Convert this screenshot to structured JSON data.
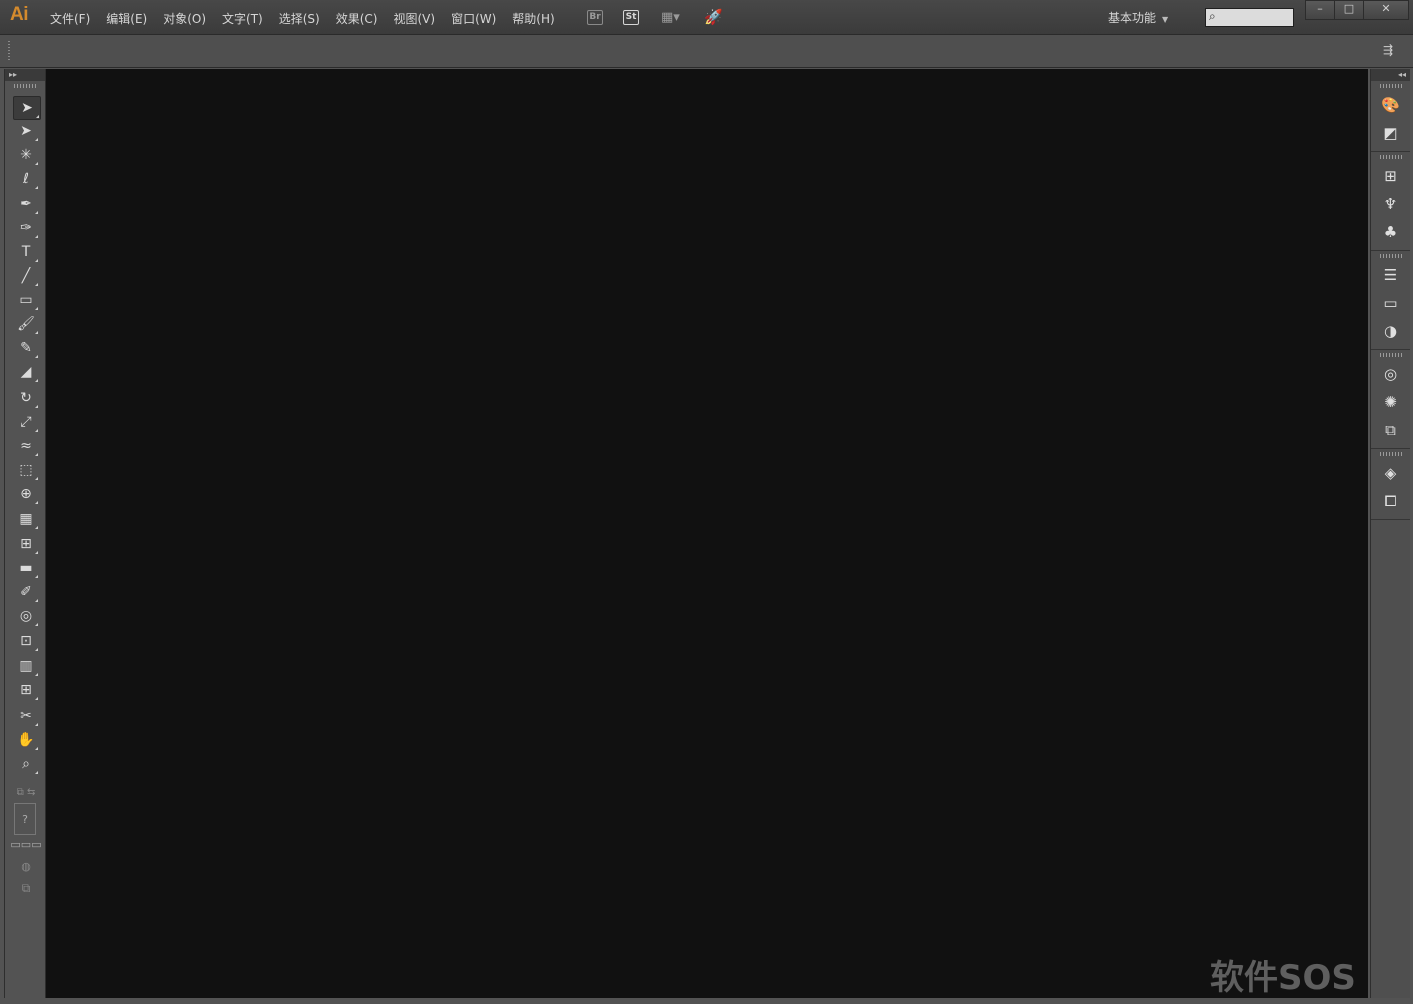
{
  "app": {
    "logo": "Ai",
    "menus": [
      "文件(F)",
      "编辑(E)",
      "对象(O)",
      "文字(T)",
      "选择(S)",
      "效果(C)",
      "视图(V)",
      "窗口(W)",
      "帮助(H)"
    ],
    "bridge_label": "Br",
    "stock_label": "St",
    "workspace": "基本功能",
    "search_placeholder": "",
    "window_controls": {
      "minimize": "–",
      "restore": "□",
      "close": "✕"
    }
  },
  "tools": [
    {
      "name": "selection-tool",
      "glyph": "➤",
      "active": true
    },
    {
      "name": "direct-selection-tool",
      "glyph": "➤"
    },
    {
      "name": "magic-wand-tool",
      "glyph": "✳"
    },
    {
      "name": "lasso-tool",
      "glyph": "ℓ"
    },
    {
      "name": "pen-tool",
      "glyph": "✒"
    },
    {
      "name": "curvature-tool",
      "glyph": "✑"
    },
    {
      "name": "type-tool",
      "glyph": "T"
    },
    {
      "name": "line-segment-tool",
      "glyph": "╱"
    },
    {
      "name": "rectangle-tool",
      "glyph": "▭"
    },
    {
      "name": "paintbrush-tool",
      "glyph": "🖌"
    },
    {
      "name": "pencil-tool",
      "glyph": "✎"
    },
    {
      "name": "eraser-tool",
      "glyph": "◢"
    },
    {
      "name": "rotate-tool",
      "glyph": "↻"
    },
    {
      "name": "scale-tool",
      "glyph": "⤢"
    },
    {
      "name": "width-tool",
      "glyph": "≈"
    },
    {
      "name": "free-transform-tool",
      "glyph": "⬚"
    },
    {
      "name": "shape-builder-tool",
      "glyph": "⊕"
    },
    {
      "name": "perspective-grid-tool",
      "glyph": "▦"
    },
    {
      "name": "mesh-tool",
      "glyph": "⊞"
    },
    {
      "name": "gradient-tool",
      "glyph": "▬"
    },
    {
      "name": "eyedropper-tool",
      "glyph": "✐"
    },
    {
      "name": "blend-tool",
      "glyph": "◎"
    },
    {
      "name": "symbol-sprayer-tool",
      "glyph": "⊡"
    },
    {
      "name": "column-graph-tool",
      "glyph": "▥"
    },
    {
      "name": "artboard-tool",
      "glyph": "⊞"
    },
    {
      "name": "slice-tool",
      "glyph": "✂"
    },
    {
      "name": "hand-tool",
      "glyph": "✋"
    },
    {
      "name": "zoom-tool",
      "glyph": "⌕"
    }
  ],
  "dock": [
    [
      "color-panel-icon",
      "color-guide-panel-icon"
    ],
    [
      "swatches-panel-icon",
      "brushes-panel-icon",
      "symbols-panel-icon"
    ],
    [
      "stroke-panel-icon",
      "gradient-panel-icon",
      "transparency-panel-icon"
    ],
    [
      "appearance-panel-icon",
      "graphic-styles-panel-icon",
      "asset-export-panel-icon"
    ],
    [
      "layers-panel-icon",
      "artboards-panel-icon"
    ]
  ],
  "dock_glyphs": {
    "color-panel-icon": "🎨",
    "color-guide-panel-icon": "◩",
    "swatches-panel-icon": "⊞",
    "brushes-panel-icon": "♆",
    "symbols-panel-icon": "♣",
    "stroke-panel-icon": "☰",
    "gradient-panel-icon": "▭",
    "transparency-panel-icon": "◑",
    "appearance-panel-icon": "◎",
    "graphic-styles-panel-icon": "✺",
    "asset-export-panel-icon": "⧉",
    "layers-panel-icon": "◈",
    "artboards-panel-icon": "⧠"
  },
  "watermark": "软件SOS",
  "colors": {
    "logo": "#d48a2d",
    "canvas": "#111111",
    "panel": "#535353"
  }
}
